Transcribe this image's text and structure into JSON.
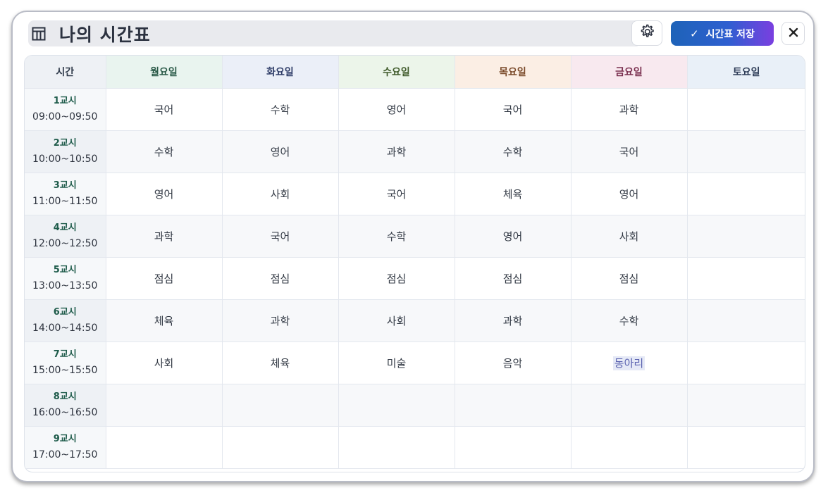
{
  "header": {
    "title": "나의 시간표",
    "title_icon": "table-icon",
    "settings_icon": "gear-icon",
    "save_label": "시간표 저장",
    "save_icon_glyph": "✓",
    "close_icon": "close-icon"
  },
  "table": {
    "time_header": "시간",
    "days": [
      {
        "label": "월요일",
        "bg": "#e9f4ef",
        "color": "#2a5a48"
      },
      {
        "label": "화요일",
        "bg": "#ebeff8",
        "color": "#2f3d68"
      },
      {
        "label": "수요일",
        "bg": "#ecf5ea",
        "color": "#3f5a2a"
      },
      {
        "label": "목요일",
        "bg": "#fbeee4",
        "color": "#7a4a2a"
      },
      {
        "label": "금요일",
        "bg": "#f8e9ef",
        "color": "#7a3050"
      },
      {
        "label": "토요일",
        "bg": "#e9f0f8",
        "color": "#2f3d58"
      }
    ],
    "rows": [
      {
        "period": "1교시",
        "time": "09:00~09:50",
        "subjects": [
          "국어",
          "수학",
          "영어",
          "국어",
          "과학",
          ""
        ]
      },
      {
        "period": "2교시",
        "time": "10:00~10:50",
        "subjects": [
          "수학",
          "영어",
          "과학",
          "수학",
          "국어",
          ""
        ]
      },
      {
        "period": "3교시",
        "time": "11:00~11:50",
        "subjects": [
          "영어",
          "사회",
          "국어",
          "체육",
          "영어",
          ""
        ]
      },
      {
        "period": "4교시",
        "time": "12:00~12:50",
        "subjects": [
          "과학",
          "국어",
          "수학",
          "영어",
          "사회",
          ""
        ]
      },
      {
        "period": "5교시",
        "time": "13:00~13:50",
        "subjects": [
          "점심",
          "점심",
          "점심",
          "점심",
          "점심",
          ""
        ]
      },
      {
        "period": "6교시",
        "time": "14:00~14:50",
        "subjects": [
          "체육",
          "과학",
          "사회",
          "과학",
          "수학",
          ""
        ]
      },
      {
        "period": "7교시",
        "time": "15:00~15:50",
        "subjects": [
          "사회",
          "체육",
          "미술",
          "음악",
          "동아리",
          ""
        ]
      },
      {
        "period": "8교시",
        "time": "16:00~16:50",
        "subjects": [
          "",
          "",
          "",
          "",
          "",
          ""
        ]
      },
      {
        "period": "9교시",
        "time": "17:00~17:50",
        "subjects": [
          "",
          "",
          "",
          "",
          "",
          ""
        ]
      }
    ],
    "highlighted_cell": {
      "row": 6,
      "col": 4
    }
  }
}
